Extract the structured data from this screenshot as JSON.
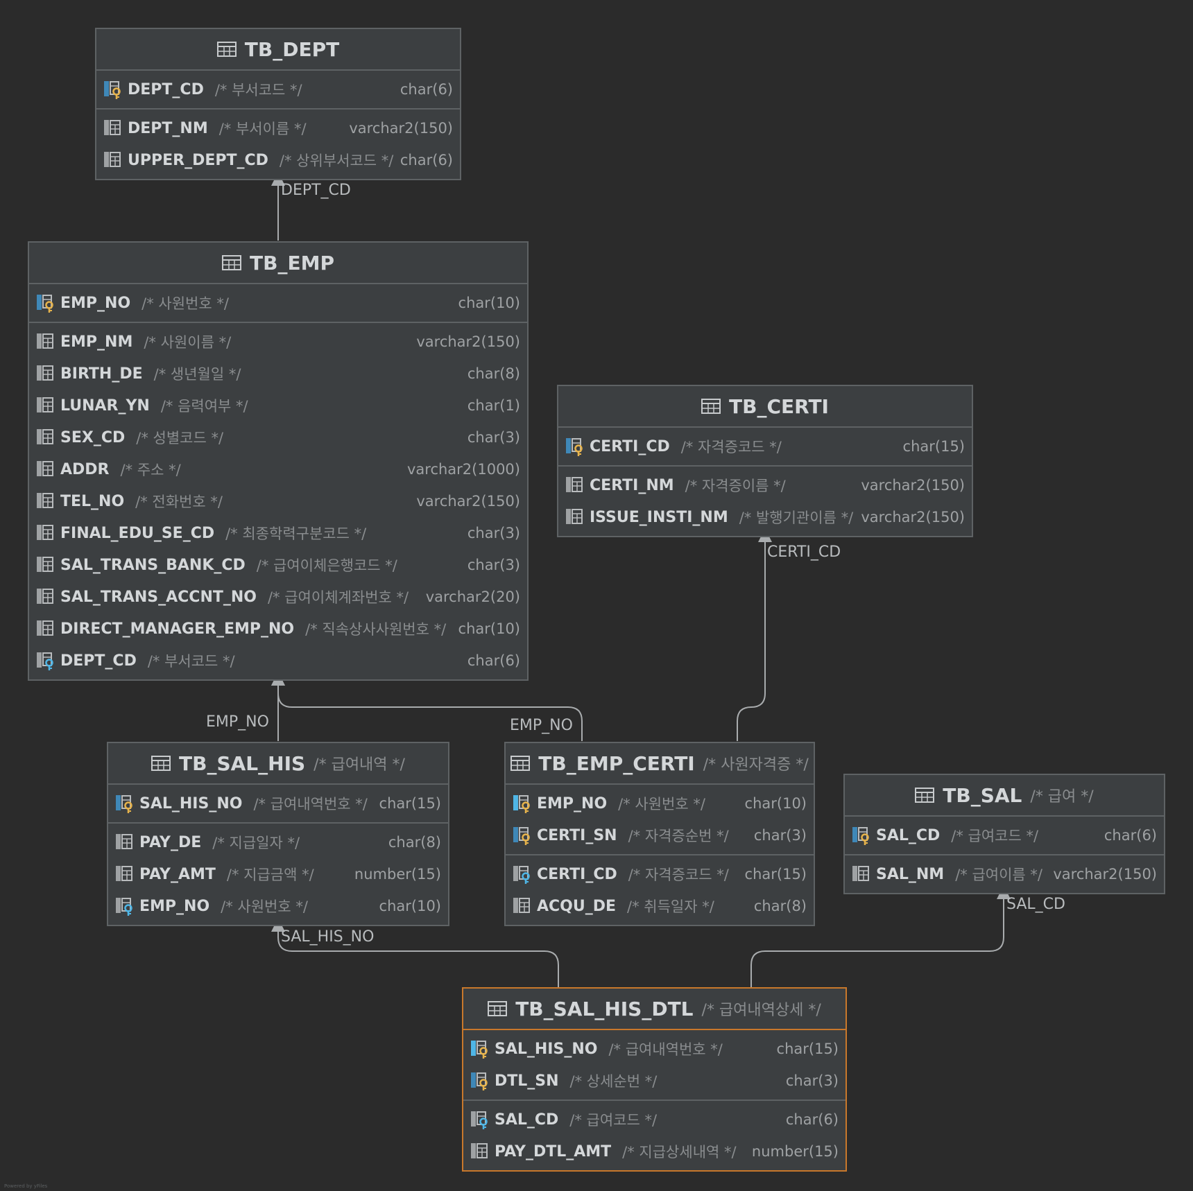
{
  "colors": {
    "background": "#2b2b2b",
    "table_fill": "#3c3f41",
    "table_border": "#5e6264",
    "selected_border": "#c9782b",
    "primary_key": "#e6b34c",
    "foreign_key": "#4fb6e6",
    "edge": "#a9acae"
  },
  "icons": {
    "table": "table-grid-icon",
    "pk": "primary-key-icon",
    "fk": "foreign-key-icon",
    "pkfk": "primary-foreign-key-icon",
    "column": "column-icon"
  },
  "tables": {
    "dept": {
      "name": "TB_DEPT",
      "comment": "",
      "sections": [
        [
          {
            "name": "DEPT_CD",
            "comment": "/* 부서코드 */",
            "type": "char(6)",
            "key": "pk"
          }
        ],
        [
          {
            "name": "DEPT_NM",
            "comment": "/* 부서이름 */",
            "type": "varchar2(150)",
            "key": "none"
          },
          {
            "name": "UPPER_DEPT_CD",
            "comment": "/* 상위부서코드 */",
            "type": "char(6)",
            "key": "none"
          }
        ]
      ]
    },
    "emp": {
      "name": "TB_EMP",
      "comment": "",
      "sections": [
        [
          {
            "name": "EMP_NO",
            "comment": "/* 사원번호 */",
            "type": "char(10)",
            "key": "pk"
          }
        ],
        [
          {
            "name": "EMP_NM",
            "comment": "/* 사원이름 */",
            "type": "varchar2(150)",
            "key": "none"
          },
          {
            "name": "BIRTH_DE",
            "comment": "/* 생년월일 */",
            "type": "char(8)",
            "key": "none"
          },
          {
            "name": "LUNAR_YN",
            "comment": "/* 음력여부 */",
            "type": "char(1)",
            "key": "none"
          },
          {
            "name": "SEX_CD",
            "comment": "/* 성별코드 */",
            "type": "char(3)",
            "key": "none"
          },
          {
            "name": "ADDR",
            "comment": "/* 주소 */",
            "type": "varchar2(1000)",
            "key": "none"
          },
          {
            "name": "TEL_NO",
            "comment": "/* 전화번호 */",
            "type": "varchar2(150)",
            "key": "none"
          },
          {
            "name": "FINAL_EDU_SE_CD",
            "comment": "/* 최종학력구분코드 */",
            "type": "char(3)",
            "key": "none"
          },
          {
            "name": "SAL_TRANS_BANK_CD",
            "comment": "/* 급여이체은행코드 */",
            "type": "char(3)",
            "key": "none"
          },
          {
            "name": "SAL_TRANS_ACCNT_NO",
            "comment": "/* 급여이체계좌번호 */",
            "type": "varchar2(20)",
            "key": "none"
          },
          {
            "name": "DIRECT_MANAGER_EMP_NO",
            "comment": "/* 직속상사사원번호 */",
            "type": "char(10)",
            "key": "none"
          },
          {
            "name": "DEPT_CD",
            "comment": "/* 부서코드 */",
            "type": "char(6)",
            "key": "fk"
          }
        ]
      ]
    },
    "certi": {
      "name": "TB_CERTI",
      "comment": "",
      "sections": [
        [
          {
            "name": "CERTI_CD",
            "comment": "/* 자격증코드 */",
            "type": "char(15)",
            "key": "pk"
          }
        ],
        [
          {
            "name": "CERTI_NM",
            "comment": "/* 자격증이름 */",
            "type": "varchar2(150)",
            "key": "none"
          },
          {
            "name": "ISSUE_INSTI_NM",
            "comment": "/* 발행기관이름 */",
            "type": "varchar2(150)",
            "key": "none"
          }
        ]
      ]
    },
    "salhis": {
      "name": "TB_SAL_HIS",
      "comment": "/* 급여내역 */",
      "sections": [
        [
          {
            "name": "SAL_HIS_NO",
            "comment": "/* 급여내역번호 */",
            "type": "char(15)",
            "key": "pk"
          }
        ],
        [
          {
            "name": "PAY_DE",
            "comment": "/* 지급일자 */",
            "type": "char(8)",
            "key": "none"
          },
          {
            "name": "PAY_AMT",
            "comment": "/* 지급금액 */",
            "type": "number(15)",
            "key": "none"
          },
          {
            "name": "EMP_NO",
            "comment": "/* 사원번호 */",
            "type": "char(10)",
            "key": "fk"
          }
        ]
      ]
    },
    "empcerti": {
      "name": "TB_EMP_CERTI",
      "comment": "/* 사원자격증 */",
      "sections": [
        [
          {
            "name": "EMP_NO",
            "comment": "/* 사원번호 */",
            "type": "char(10)",
            "key": "pkfk"
          },
          {
            "name": "CERTI_SN",
            "comment": "/* 자격증순번 */",
            "type": "char(3)",
            "key": "pk"
          }
        ],
        [
          {
            "name": "CERTI_CD",
            "comment": "/* 자격증코드 */",
            "type": "char(15)",
            "key": "fk"
          },
          {
            "name": "ACQU_DE",
            "comment": "/* 취득일자 */",
            "type": "char(8)",
            "key": "none"
          }
        ]
      ]
    },
    "sal": {
      "name": "TB_SAL",
      "comment": "/* 급여 */",
      "sections": [
        [
          {
            "name": "SAL_CD",
            "comment": "/* 급여코드 */",
            "type": "char(6)",
            "key": "pk"
          }
        ],
        [
          {
            "name": "SAL_NM",
            "comment": "/* 급여이름 */",
            "type": "varchar2(150)",
            "key": "none"
          }
        ]
      ]
    },
    "salhisdtl": {
      "name": "TB_SAL_HIS_DTL",
      "comment": "/* 급여내역상세 */",
      "sections": [
        [
          {
            "name": "SAL_HIS_NO",
            "comment": "/* 급여내역번호 */",
            "type": "char(15)",
            "key": "pkfk"
          },
          {
            "name": "DTL_SN",
            "comment": "/* 상세순번 */",
            "type": "char(3)",
            "key": "pk"
          }
        ],
        [
          {
            "name": "SAL_CD",
            "comment": "/* 급여코드 */",
            "type": "char(6)",
            "key": "fk"
          },
          {
            "name": "PAY_DTL_AMT",
            "comment": "/* 지급상세내역 */",
            "type": "number(15)",
            "key": "none"
          }
        ]
      ]
    }
  },
  "edges": {
    "emp_dept": "DEPT_CD",
    "salhis_emp": "EMP_NO",
    "empcerti_emp": "EMP_NO",
    "empcerti_certi": "CERTI_CD",
    "dtl_salhis": "SAL_HIS_NO",
    "dtl_sal": "SAL_CD"
  },
  "credit": "Powered by yFiles"
}
